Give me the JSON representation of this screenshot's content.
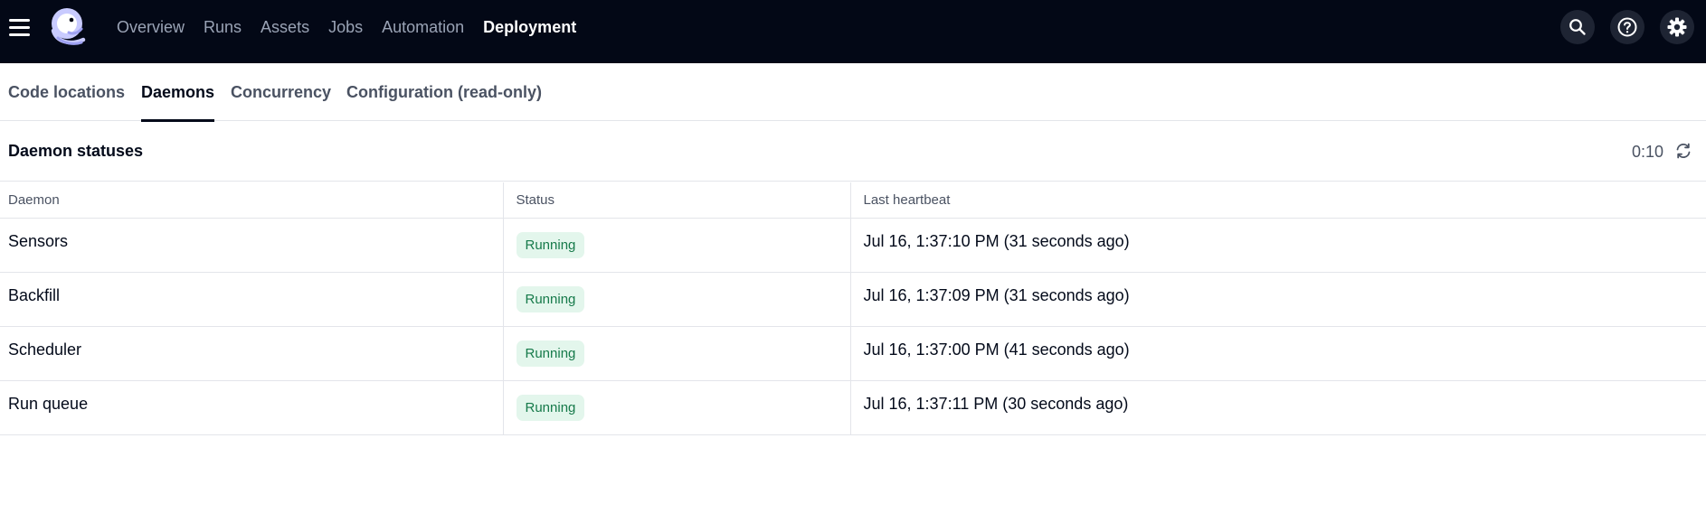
{
  "topbar": {
    "nav": [
      "Overview",
      "Runs",
      "Assets",
      "Jobs",
      "Automation",
      "Deployment"
    ],
    "active_nav": "Deployment",
    "icons": [
      "menu-icon",
      "dagster-logo",
      "search-icon",
      "help-icon",
      "gear-icon"
    ]
  },
  "tabs": [
    "Code locations",
    "Daemons",
    "Concurrency",
    "Configuration (read-only)"
  ],
  "active_tab": "Daemons",
  "section": {
    "title": "Daemon statuses",
    "refresh_countdown": "0:10",
    "refresh_icon": "refresh-icon"
  },
  "table": {
    "headers": [
      "Daemon",
      "Status",
      "Last heartbeat"
    ],
    "rows": [
      {
        "daemon": "Sensors",
        "status": "Running",
        "heartbeat": "Jul 16, 1:37:10 PM (31 seconds ago)"
      },
      {
        "daemon": "Backfill",
        "status": "Running",
        "heartbeat": "Jul 16, 1:37:09 PM (31 seconds ago)"
      },
      {
        "daemon": "Scheduler",
        "status": "Running",
        "heartbeat": "Jul 16, 1:37:00 PM (41 seconds ago)"
      },
      {
        "daemon": "Run queue",
        "status": "Running",
        "heartbeat": "Jul 16, 1:37:11 PM (30 seconds ago)"
      }
    ]
  },
  "colors": {
    "topbar_bg": "#030816",
    "badge_bg": "#e3f6ec",
    "badge_text": "#167a4a"
  }
}
